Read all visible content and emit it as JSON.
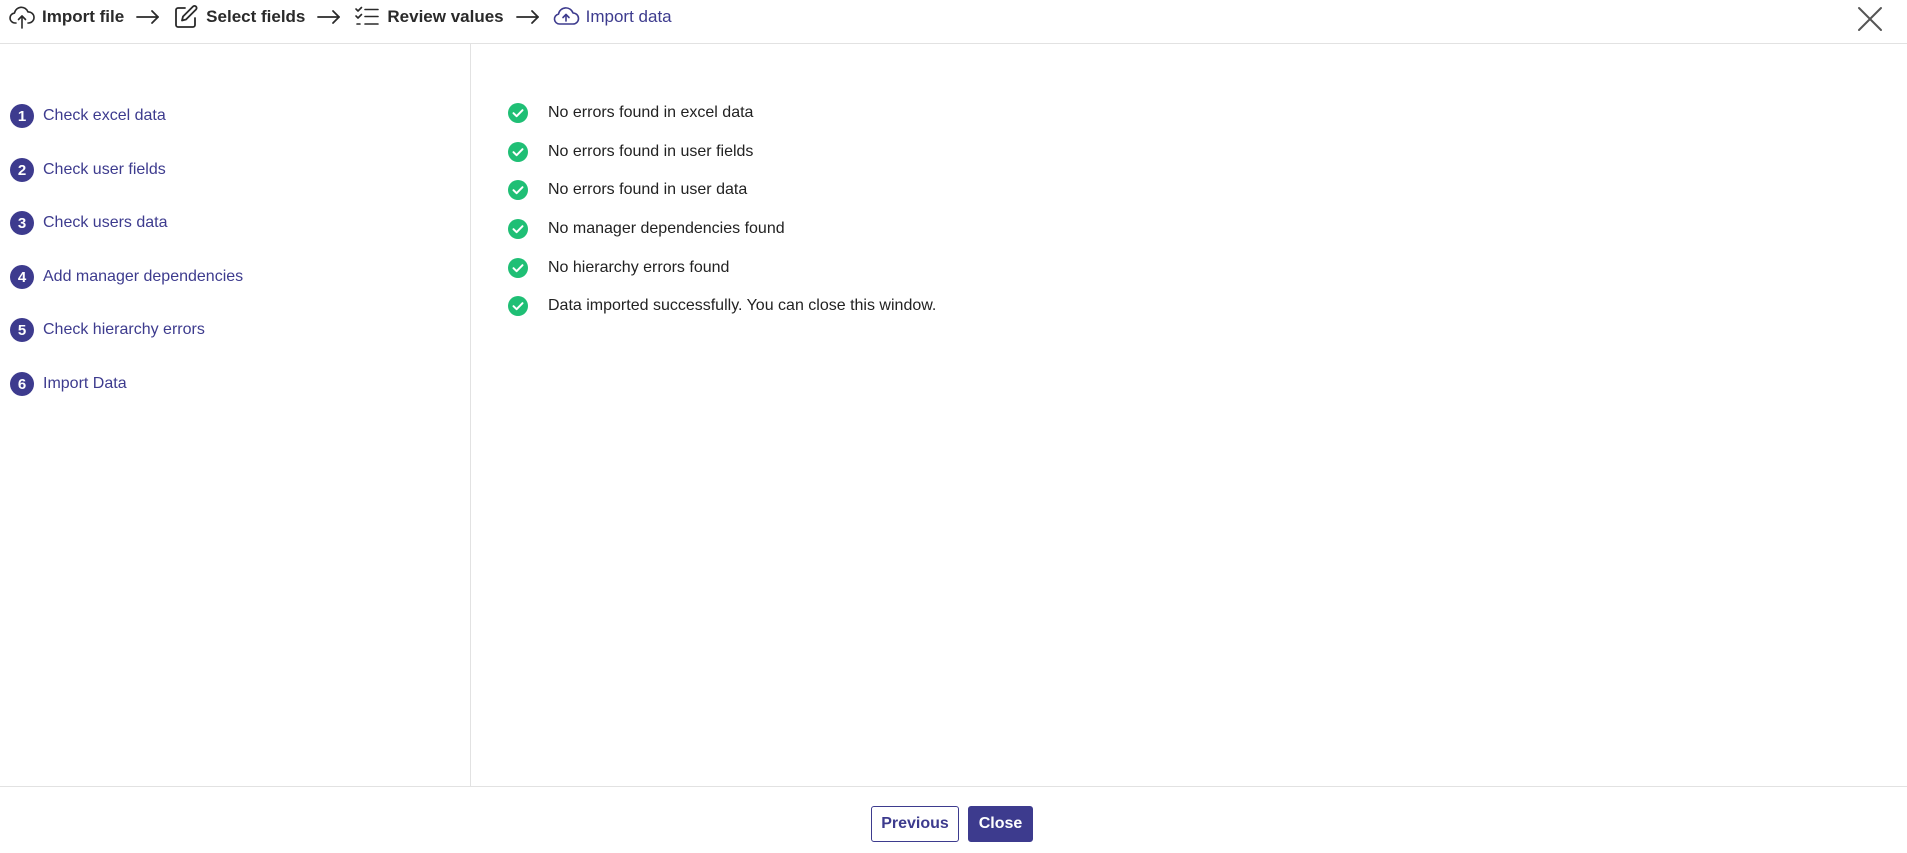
{
  "wizard": {
    "steps": [
      {
        "label": "Import file",
        "icon": "cloud-upload-icon"
      },
      {
        "label": "Select fields",
        "icon": "edit-icon"
      },
      {
        "label": "Review values",
        "icon": "checklist-icon"
      },
      {
        "label": "Import data",
        "icon": "cloud-upload-icon"
      }
    ],
    "active_step": 3,
    "close_icon": "close-icon"
  },
  "sidebar": {
    "items": [
      {
        "number": "1",
        "label": "Check excel data"
      },
      {
        "number": "2",
        "label": "Check user fields"
      },
      {
        "number": "3",
        "label": "Check users data"
      },
      {
        "number": "4",
        "label": "Add manager dependencies"
      },
      {
        "number": "5",
        "label": "Check hierarchy errors"
      },
      {
        "number": "6",
        "label": "Import Data"
      }
    ]
  },
  "results": {
    "items": [
      {
        "text": "No errors found in excel data",
        "icon": "check-circle-icon"
      },
      {
        "text": "No errors found in user fields",
        "icon": "check-circle-icon"
      },
      {
        "text": "No errors found in user data",
        "icon": "check-circle-icon"
      },
      {
        "text": "No manager dependencies found",
        "icon": "check-circle-icon"
      },
      {
        "text": "No hierarchy errors found",
        "icon": "check-circle-icon"
      },
      {
        "text": "Data imported successfully. You can close this window.",
        "icon": "check-circle-icon"
      }
    ]
  },
  "footer": {
    "previous_label": "Previous",
    "close_label": "Close"
  },
  "colors": {
    "accent": "#3d3b8e",
    "success": "#1fbf75",
    "border": "#e2e2e2"
  }
}
